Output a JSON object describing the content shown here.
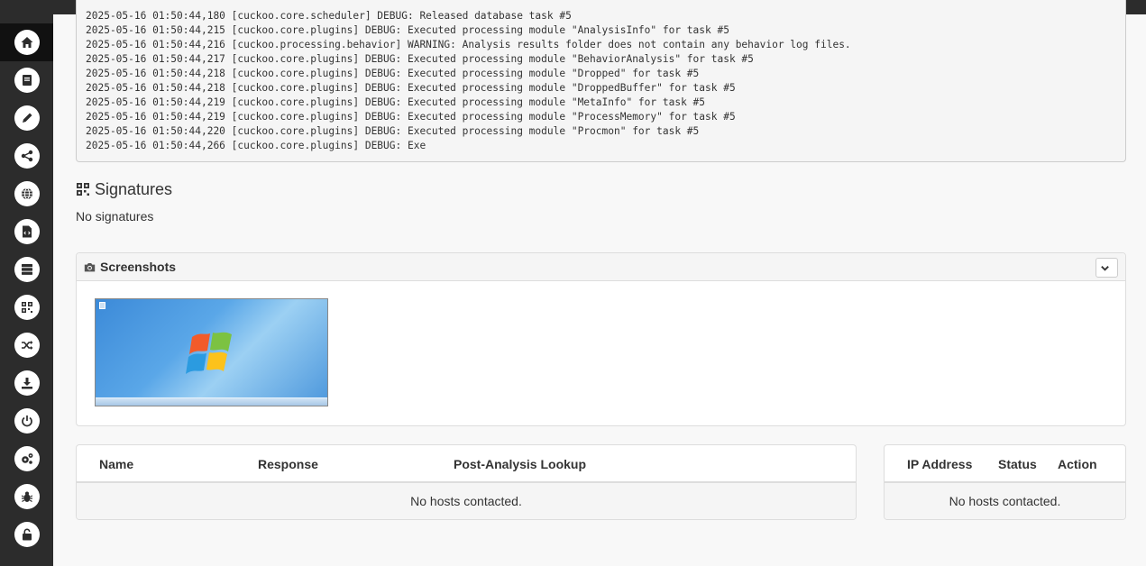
{
  "log": {
    "lines": [
      "2025-05-16 01:50:44,180 [cuckoo.core.scheduler] DEBUG: Released database task #5",
      "2025-05-16 01:50:44,215 [cuckoo.core.plugins] DEBUG: Executed processing module \"AnalysisInfo\" for task #5",
      "2025-05-16 01:50:44,216 [cuckoo.processing.behavior] WARNING: Analysis results folder does not contain any behavior log files.",
      "2025-05-16 01:50:44,217 [cuckoo.core.plugins] DEBUG: Executed processing module \"BehaviorAnalysis\" for task #5",
      "2025-05-16 01:50:44,218 [cuckoo.core.plugins] DEBUG: Executed processing module \"Dropped\" for task #5",
      "2025-05-16 01:50:44,218 [cuckoo.core.plugins] DEBUG: Executed processing module \"DroppedBuffer\" for task #5",
      "2025-05-16 01:50:44,219 [cuckoo.core.plugins] DEBUG: Executed processing module \"MetaInfo\" for task #5",
      "2025-05-16 01:50:44,219 [cuckoo.core.plugins] DEBUG: Executed processing module \"ProcessMemory\" for task #5",
      "2025-05-16 01:50:44,220 [cuckoo.core.plugins] DEBUG: Executed processing module \"Procmon\" for task #5",
      "2025-05-16 01:50:44,266 [cuckoo.core.plugins] DEBUG: Exe"
    ]
  },
  "signatures": {
    "title": "Signatures",
    "icon": "qrcode-icon",
    "empty_text": "No signatures"
  },
  "screenshots": {
    "title": "Screenshots",
    "icon": "camera-icon",
    "collapse_icon": "chevron-down-icon",
    "thumbnail": "windows-7-desktop-screenshot"
  },
  "dns_table": {
    "headers": [
      "Name",
      "Response",
      "Post-Analysis Lookup"
    ],
    "empty_text": "No hosts contacted."
  },
  "hosts_table": {
    "headers": [
      "IP Address",
      "Status",
      "Action"
    ],
    "empty_text": "No hosts contacted."
  },
  "sidebar": {
    "items": [
      {
        "icon": "home-icon",
        "active": true
      },
      {
        "icon": "book-icon"
      },
      {
        "icon": "pencil-icon"
      },
      {
        "icon": "share-icon"
      },
      {
        "icon": "globe-icon"
      },
      {
        "icon": "file-code-icon"
      },
      {
        "icon": "server-icon"
      },
      {
        "icon": "qrcode-icon"
      },
      {
        "icon": "random-icon"
      },
      {
        "icon": "download-icon"
      },
      {
        "icon": "power-icon"
      },
      {
        "icon": "cogs-icon"
      },
      {
        "icon": "bug-icon"
      },
      {
        "icon": "unlock-icon"
      }
    ]
  },
  "colors": {
    "sidebar_bg": "#2c2c2c",
    "page_bg": "#f8f8f8",
    "panel_head_bg": "#f5f5f5"
  }
}
